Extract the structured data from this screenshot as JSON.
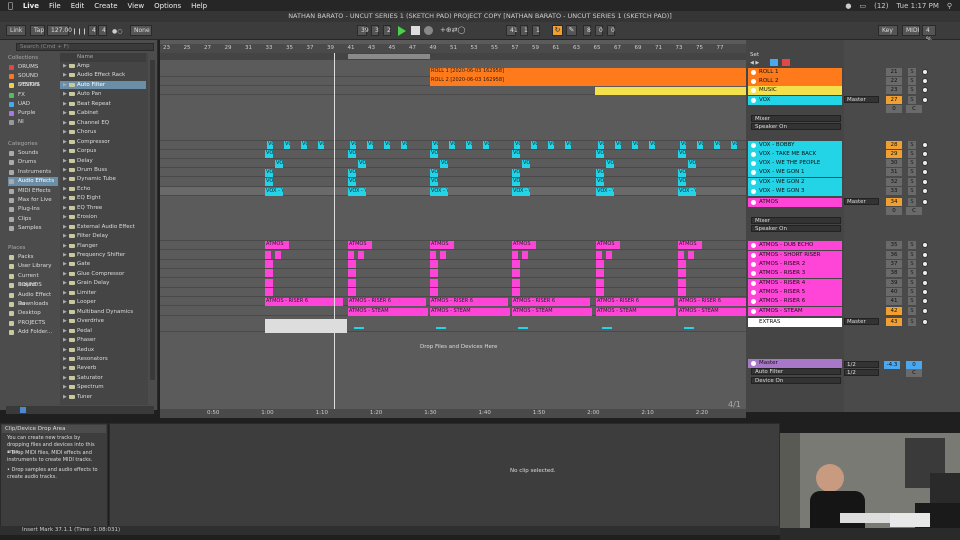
{
  "menubar": {
    "app": "Live",
    "items": [
      "File",
      "Edit",
      "Create",
      "View",
      "Options",
      "Help"
    ],
    "right": [
      "(12)",
      "Tue 1:17 PM"
    ]
  },
  "window": {
    "title": "NATHAN BARATO - UNCUT SERIES 1 (SKETCH PAD) PROJECT COPY  [NATHAN BARATO - UNCUT SERIES 1 (SKETCH PAD)]"
  },
  "transport": {
    "link": "Link",
    "tap": "Tap",
    "tempo": "127.00",
    "sig_num": "4",
    "sig_den": "4",
    "quant": "None",
    "position": [
      "39",
      ".",
      "3",
      ".",
      "2"
    ],
    "loop_start": [
      "41",
      ".",
      "1",
      ".",
      "1"
    ],
    "loop_len": [
      "8",
      ".",
      "0",
      ".",
      "0"
    ],
    "key": "Key",
    "midi": "MIDI",
    "cpu": "4 %"
  },
  "browser": {
    "search": "Search (Cmd + F)",
    "collections_head": "Collections",
    "collections": [
      {
        "label": "DRUMS",
        "color": "#e04848"
      },
      {
        "label": "SOUND DESIGN",
        "color": "#f07b30"
      },
      {
        "label": "SYNTHS",
        "color": "#e8d34a"
      },
      {
        "label": "FX",
        "color": "#4cc25c"
      },
      {
        "label": "UAD",
        "color": "#4aa8f0"
      },
      {
        "label": "Purple",
        "color": "#a878e8"
      },
      {
        "label": "NI",
        "color": "#999999"
      }
    ],
    "categories_head": "Categories",
    "categories": [
      "Sounds",
      "Drums",
      "Instruments",
      "Audio Effects",
      "MIDI Effects",
      "Max for Live",
      "Plug-Ins",
      "Clips",
      "Samples"
    ],
    "places_head": "Places",
    "places": [
      "Packs",
      "User Library",
      "Current Project",
      "SOUNDS",
      "Audio Effect Ra",
      "Downloads",
      "Desktop",
      "PROJECTS",
      "Add Folder..."
    ],
    "list_head": "Name",
    "items": [
      "Amp",
      "Audio Effect Rack",
      "Auto Filter",
      "Auto Pan",
      "Beat Repeat",
      "Cabinet",
      "Channel EQ",
      "Chorus",
      "Compressor",
      "Corpus",
      "Delay",
      "Drum Buss",
      "Dynamic Tube",
      "Echo",
      "EQ Eight",
      "EQ Three",
      "Erosion",
      "External Audio Effect",
      "Filter Delay",
      "Flanger",
      "Frequency Shifter",
      "Gate",
      "Glue Compressor",
      "Grain Delay",
      "Limiter",
      "Looper",
      "Multiband Dynamics",
      "Overdrive",
      "Pedal",
      "Phaser",
      "Redux",
      "Resonators",
      "Reverb",
      "Saturator",
      "Spectrum",
      "Tuner"
    ]
  },
  "ruler": {
    "bars": [
      "23",
      "25",
      "27",
      "29",
      "31",
      "33",
      "35",
      "37",
      "39",
      "41",
      "43",
      "45",
      "47",
      "49",
      "51",
      "53",
      "55",
      "57",
      "59",
      "61",
      "63",
      "65",
      "67",
      "69",
      "71",
      "73",
      "75",
      "77"
    ],
    "times": [
      "0:50",
      "1:00",
      "1:10",
      "1:20",
      "1:30",
      "1:40",
      "1:50",
      "2:00",
      "2:10",
      "2:20"
    ],
    "signature": "4/1"
  },
  "clips": {
    "roll1": "ROLL 1 [2020-06-03 162958]",
    "roll2": "ROLL 2 [2020-06-03 162958]",
    "vox": "VOX",
    "vox_v": "VOX - V",
    "atmos": "ATMOS",
    "atmos_riser6": "ATMOS - RISER 6",
    "atmos_steam": "ATMOS - STEAM",
    "drop_text": "Drop Files and Devices Here"
  },
  "tracks": [
    {
      "name": "ROLL 1",
      "color": "#ff7a1a",
      "num": "21"
    },
    {
      "name": "ROLL 2",
      "color": "#ff7a1a",
      "num": "22"
    },
    {
      "name": "MUSIC",
      "color": "#f4e04a",
      "num": "23"
    },
    {
      "name": "VOX",
      "color": "#22d4e6",
      "num": "27"
    },
    {
      "name": "VOX - BOBBY",
      "color": "#22d4e6",
      "num": "28"
    },
    {
      "name": "VOX - TAKE ME BACK",
      "color": "#22d4e6",
      "num": "29"
    },
    {
      "name": "VOX - WE THE PEOPLE",
      "color": "#22d4e6",
      "num": "30"
    },
    {
      "name": "VOX - WE GON 1",
      "color": "#22d4e6",
      "num": "31"
    },
    {
      "name": "VOX - WE GON 2",
      "color": "#22d4e6",
      "num": "32"
    },
    {
      "name": "VOX - WE GON 3",
      "color": "#22d4e6",
      "num": "33"
    },
    {
      "name": "ATMOS",
      "color": "#ff45d8",
      "num": "34"
    },
    {
      "name": "ATMOS - DUB ECHO",
      "color": "#ff45d8",
      "num": "35"
    },
    {
      "name": "ATMOS - SHORT RISER",
      "color": "#ff45d8",
      "num": "36"
    },
    {
      "name": "ATMOS - RISER 2",
      "color": "#ff45d8",
      "num": "37"
    },
    {
      "name": "ATMOS - RISER 3",
      "color": "#ff45d8",
      "num": "38"
    },
    {
      "name": "ATMOS - RISER 4",
      "color": "#ff45d8",
      "num": "39"
    },
    {
      "name": "ATMOS - RISER 5",
      "color": "#ff45d8",
      "num": "40"
    },
    {
      "name": "ATMOS - RISER 6",
      "color": "#ff45d8",
      "num": "41"
    },
    {
      "name": "ATMOS - STEAM",
      "color": "#ff45d8",
      "num": "42"
    },
    {
      "name": "EXTRAS",
      "color": "#ffffff",
      "num": "43"
    }
  ],
  "devices": {
    "mixer": "Mixer",
    "speaker": "Speaker On",
    "auto_filter": "Auto Filter",
    "device_on": "Device On",
    "master": "Master",
    "out": "Master",
    "half": "1/2",
    "vol": "-4.3",
    "zero": "0",
    "c": "C",
    "s": "S",
    "set": "Set"
  },
  "drop_area": {
    "title": "Clip/Device Drop Area",
    "intro": "You can create new tracks by dropping files and devices into this area:",
    "bullet1": "Drop MIDI files, MIDI effects and instruments to create MIDI tracks.",
    "bullet2": "Drop samples and audio effects to create audio tracks."
  },
  "detail": {
    "no_clip": "No clip selected."
  },
  "status": {
    "text": "Insert Mark 37.1.1 (Time: 1:08:031)"
  }
}
